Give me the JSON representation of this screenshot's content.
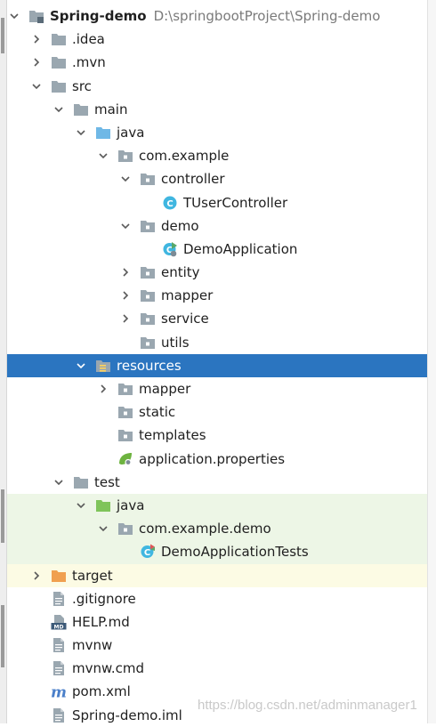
{
  "colors": {
    "selection": "#2b75c0",
    "test_background": "#edf6e6",
    "excluded_background": "#fcfbe4"
  },
  "tree": [
    {
      "label": "Spring-demo",
      "path": "D:\\springbootProject\\Spring-demo",
      "depth": 0,
      "arrow": "down",
      "icon": "module-folder-icon",
      "bold": true
    },
    {
      "label": ".idea",
      "depth": 1,
      "arrow": "right",
      "icon": "folder-icon"
    },
    {
      "label": ".mvn",
      "depth": 1,
      "arrow": "right",
      "icon": "folder-icon"
    },
    {
      "label": "src",
      "depth": 1,
      "arrow": "down",
      "icon": "folder-icon"
    },
    {
      "label": "main",
      "depth": 2,
      "arrow": "down",
      "icon": "folder-icon"
    },
    {
      "label": "java",
      "depth": 3,
      "arrow": "down",
      "icon": "source-folder-icon"
    },
    {
      "label": "com.example",
      "depth": 4,
      "arrow": "down",
      "icon": "package-icon"
    },
    {
      "label": "controller",
      "depth": 5,
      "arrow": "down",
      "icon": "package-icon"
    },
    {
      "label": "TUserController",
      "depth": 6,
      "arrow": "none",
      "icon": "class-icon"
    },
    {
      "label": "demo",
      "depth": 5,
      "arrow": "down",
      "icon": "package-icon"
    },
    {
      "label": "DemoApplication",
      "depth": 6,
      "arrow": "none",
      "icon": "spring-boot-class-icon"
    },
    {
      "label": "entity",
      "depth": 5,
      "arrow": "right",
      "icon": "package-icon"
    },
    {
      "label": "mapper",
      "depth": 5,
      "arrow": "right",
      "icon": "package-icon"
    },
    {
      "label": "service",
      "depth": 5,
      "arrow": "right",
      "icon": "package-icon"
    },
    {
      "label": "utils",
      "depth": 5,
      "arrow": "none",
      "icon": "package-icon"
    },
    {
      "label": "resources",
      "depth": 3,
      "arrow": "down",
      "icon": "resources-folder-icon",
      "selected": true
    },
    {
      "label": "mapper",
      "depth": 4,
      "arrow": "right",
      "icon": "package-icon"
    },
    {
      "label": "static",
      "depth": 4,
      "arrow": "none",
      "icon": "package-icon"
    },
    {
      "label": "templates",
      "depth": 4,
      "arrow": "none",
      "icon": "package-icon"
    },
    {
      "label": "application.properties",
      "depth": 4,
      "arrow": "none",
      "icon": "spring-config-icon"
    },
    {
      "label": "test",
      "depth": 2,
      "arrow": "down",
      "icon": "folder-icon"
    },
    {
      "label": "java",
      "depth": 3,
      "arrow": "down",
      "icon": "test-source-folder-icon",
      "bg": "test"
    },
    {
      "label": "com.example.demo",
      "depth": 4,
      "arrow": "down",
      "icon": "package-icon",
      "bg": "test"
    },
    {
      "label": "DemoApplicationTests",
      "depth": 5,
      "arrow": "none",
      "icon": "test-class-icon",
      "bg": "test"
    },
    {
      "label": "target",
      "depth": 1,
      "arrow": "right",
      "icon": "excluded-folder-icon",
      "bg": "target"
    },
    {
      "label": ".gitignore",
      "depth": 1,
      "arrow": "none",
      "icon": "text-file-icon"
    },
    {
      "label": "HELP.md",
      "depth": 1,
      "arrow": "none",
      "icon": "markdown-file-icon"
    },
    {
      "label": "mvnw",
      "depth": 1,
      "arrow": "none",
      "icon": "text-file-icon"
    },
    {
      "label": "mvnw.cmd",
      "depth": 1,
      "arrow": "none",
      "icon": "text-file-icon"
    },
    {
      "label": "pom.xml",
      "depth": 1,
      "arrow": "none",
      "icon": "maven-file-icon"
    },
    {
      "label": "Spring-demo.iml",
      "depth": 1,
      "arrow": "none",
      "icon": "text-file-icon"
    }
  ],
  "watermark": "https://blog.csdn.net/adminmanager1"
}
